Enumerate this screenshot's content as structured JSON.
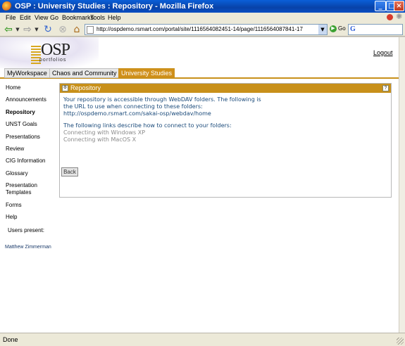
{
  "window": {
    "title": "OSP : University Studies : Repository - Mozilla Firefox",
    "minimize": "_",
    "maximize": "□",
    "close": "×"
  },
  "menu": [
    "File",
    "Edit",
    "View",
    "Go",
    "Bookmarks",
    "Tools",
    "Help"
  ],
  "toolbar": {
    "url": "http://ospdemo.rsmart.com/portal/site/1116564082451-14/page/1116564087841-17",
    "go_label": "Go",
    "search_engine_glyph": "G"
  },
  "site": {
    "logo_text": "OSP",
    "logo_sub": "portfolios",
    "logout": "Logout",
    "tabs": [
      "MyWorkspace",
      "Chaos and Community",
      "University Studies"
    ],
    "active_tab": "University Studies"
  },
  "leftnav": {
    "items": [
      "Home",
      "Announcements",
      "Repository",
      "UNST Goals",
      "Presentations",
      "Review",
      "CIG Information",
      "Glossary",
      "Presentation Templates",
      "Forms",
      "Help"
    ],
    "current": "Repository",
    "users_label": "Users present:",
    "user": "Matthew Zimmerman"
  },
  "portlet": {
    "title": "Repository",
    "help": "?",
    "para1_line1": "Your repository is accessible through WebDAV folders. The following is",
    "para1_line2": "the URL to use when connecting to these folders:",
    "dav_url": "http://ospdemo.rsmart.com/sakai-osp/webdav/home",
    "para2": "The following links describe how to connect to your folders:",
    "link_xp": "Connecting with Windows XP",
    "link_mac": "Connecting with MacOS X",
    "back": "Back"
  },
  "status": {
    "text": "Done"
  },
  "colors": {
    "accent": "#c8901a",
    "body_text": "#1a4a7a",
    "link_gray": "#8a8a8a"
  }
}
